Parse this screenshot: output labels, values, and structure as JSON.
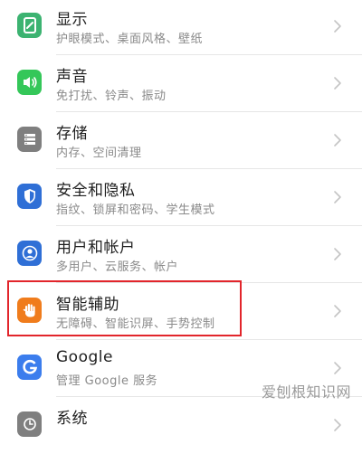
{
  "settings_items": [
    {
      "title": "显示",
      "subtitle": "护眼模式、桌面风格、壁纸",
      "icon": "display-icon",
      "color": "#3cb371"
    },
    {
      "title": "声音",
      "subtitle": "免打扰、铃声、振动",
      "icon": "sound-icon",
      "color": "#34c759"
    },
    {
      "title": "存储",
      "subtitle": "内存、空间清理",
      "icon": "storage-icon",
      "color": "#7f7f7f"
    },
    {
      "title": "安全和隐私",
      "subtitle": "指纹、锁屏和密码、学生模式",
      "icon": "security-shield-icon",
      "color": "#2f6fd6"
    },
    {
      "title": "用户和帐户",
      "subtitle": "多用户、云服务、帐户",
      "icon": "user-account-icon",
      "color": "#2f6fd6"
    },
    {
      "title": "智能辅助",
      "subtitle": "无障碍、智能识屏、手势控制",
      "icon": "hand-icon",
      "color": "#f07c1c"
    },
    {
      "title": "Google",
      "subtitle": "管理 Google 服务",
      "icon": "google-icon",
      "color": "#3b7ded"
    },
    {
      "title": "系统",
      "subtitle": "",
      "icon": "system-icon",
      "color": "#7f7f7f"
    }
  ],
  "highlight_color": "#e2252b",
  "watermark": "爱刨根知识网"
}
